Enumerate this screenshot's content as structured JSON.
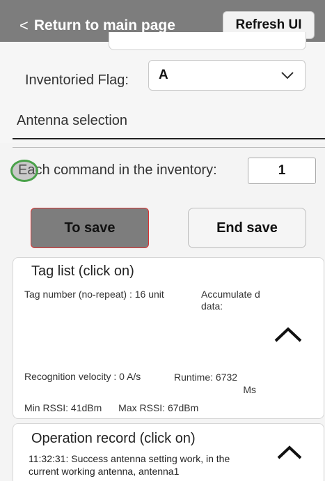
{
  "header": {
    "back_label": "Return to main page",
    "back_icon": "chevron-left-icon",
    "refresh_label": "Refresh UI",
    "bg_color": "#7d7d7d"
  },
  "inventoried_flag": {
    "label": "Inventoried Flag:",
    "value": "A"
  },
  "antenna": {
    "label": "Antenna selection"
  },
  "each_command": {
    "label": "Each command in the inventory:",
    "value": "1"
  },
  "buttons": {
    "save_label": "To save",
    "end_save_label": "End save"
  },
  "tag_list": {
    "title": "Tag list (click on)",
    "tag_number": "Tag number (no-repeat) : 16 unit",
    "accumulated": "Accumulate d data:",
    "velocity": "Recognition velocity : 0 A/s",
    "runtime_label": "Runtime: 6732",
    "runtime_unit": "Ms",
    "min_rssi": "Min RSSI: 41dBm",
    "max_rssi": "Max RSSI: 67dBm"
  },
  "operation": {
    "title": "Operation record (click on)",
    "text": "11:32:31: Success antenna setting work, in the current working antenna, antenna1"
  }
}
